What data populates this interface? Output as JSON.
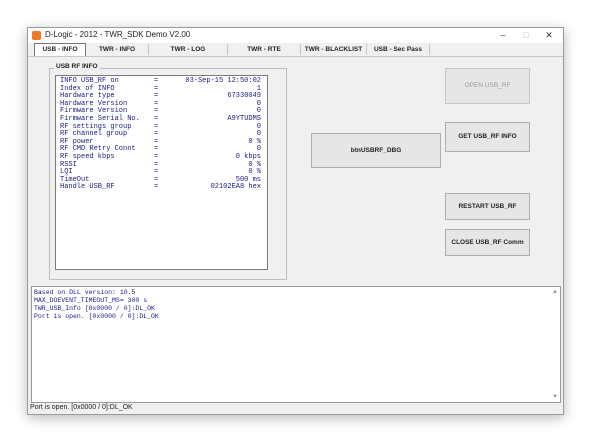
{
  "window": {
    "title": "D-Logic - 2012 - TWR_SDK Demo V2.00",
    "minimize": "–",
    "maximize": "□",
    "close": "✕"
  },
  "tabs": [
    {
      "label": "USB - INFO"
    },
    {
      "label": "TWR - INFO"
    },
    {
      "label": "TWR - LOG"
    },
    {
      "label": "TWR - RTE"
    },
    {
      "label": "TWR - BLACKLIST"
    },
    {
      "label": "USB - Sec Pass"
    }
  ],
  "usb_info": {
    "group_title": "USB RF INFO",
    "rows": [
      {
        "label": "INFO USB_RF on",
        "eq": "=",
        "value": "03-Sep-15 12:50:02"
      },
      {
        "label": "Index of INFO",
        "eq": "=",
        "value": "1"
      },
      {
        "label": "Hardware type",
        "eq": "=",
        "value": "67330049"
      },
      {
        "label": "Hardware Version",
        "eq": "=",
        "value": "0"
      },
      {
        "label": "Firmware Version",
        "eq": "=",
        "value": "0"
      },
      {
        "label": "Firmware Serial No.",
        "eq": "=",
        "value": "A9YTUDMS"
      },
      {
        "label": "RF settings group",
        "eq": "=",
        "value": "0"
      },
      {
        "label": "RF channel group",
        "eq": "=",
        "value": "0"
      },
      {
        "label": "RF power",
        "eq": "=",
        "value": "0 %"
      },
      {
        "label": "RF CMD Retry Connt",
        "eq": "=",
        "value": "0"
      },
      {
        "label": "RF speed kbps",
        "eq": "=",
        "value": "0 kbps"
      },
      {
        "label": "RSSI",
        "eq": "=",
        "value": "0 %"
      },
      {
        "label": "LQI",
        "eq": "=",
        "value": "0 %"
      },
      {
        "label": "TimeOut",
        "eq": "=",
        "value": "500 ms"
      },
      {
        "label": "Handle USB_RF",
        "eq": "=",
        "value": "02102EA8 hex"
      }
    ]
  },
  "buttons": {
    "open": "OPEN USB_RF",
    "debug": "btnUSBRF_DBG",
    "get_info": "GET USB_RF INFO",
    "restart": "RESTART USB_RF",
    "close_comm": "CLOSE USB_RF Comm"
  },
  "log": {
    "lines": [
      "Based on DLL version: 10.5",
      "MAX_DOEVENT_TIMEOUT_MS= 300 s",
      "TWR_USB_Info [0x0000 / 0]:DL_OK",
      "Port is open. [0x0000 / 0]:DL_OK"
    ]
  },
  "status": {
    "text": "Port is open. [0x0000 / 0]:DL_OK"
  }
}
